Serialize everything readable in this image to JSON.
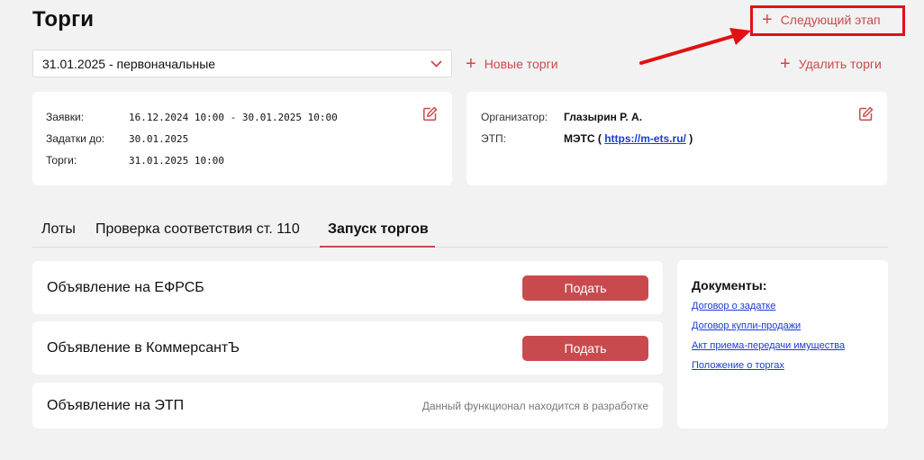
{
  "header": {
    "title": "Торги",
    "next_stage_label": "Следующий этап"
  },
  "trade_select": {
    "value": "31.01.2025 - первоначальные"
  },
  "actions": {
    "new_trade_label": "Новые торги",
    "delete_trade_label": "Удалить торги"
  },
  "dates_card": {
    "rows": [
      {
        "label": "Заявки:",
        "value": "16.12.2024 10:00 - 30.01.2025 10:00"
      },
      {
        "label": "Задатки до:",
        "value": "30.01.2025"
      },
      {
        "label": "Торги:",
        "value": "31.01.2025 10:00"
      }
    ]
  },
  "org_card": {
    "organizer_label": "Организатор:",
    "organizer_value": "Глазырин Р. А.",
    "etp_label": "ЭТП:",
    "etp_name": "МЭТС (",
    "etp_link": "https://m-ets.ru/",
    "etp_close": ")"
  },
  "tabs": [
    {
      "label": "Лоты"
    },
    {
      "label": "Проверка соответствия ст. 110"
    },
    {
      "label": "Запуск торгов"
    }
  ],
  "announcements": [
    {
      "title": "Объявление на ЕФРСБ",
      "button": "Подать"
    },
    {
      "title": "Объявление в КоммерсантЪ",
      "button": "Подать"
    },
    {
      "title": "Объявление на ЭТП",
      "note": "Данный функционал находится в разработке"
    }
  ],
  "documents": {
    "title": "Документы:",
    "links": [
      "Договор о задатке",
      "Договор купли-продажи",
      "Акт приема-передачи имущества",
      "Положение о торгах"
    ]
  },
  "colors": {
    "accent": "#c94a4e",
    "highlight_box": "#e01212",
    "link": "#1a3bd6",
    "background": "#f2f2f2"
  }
}
